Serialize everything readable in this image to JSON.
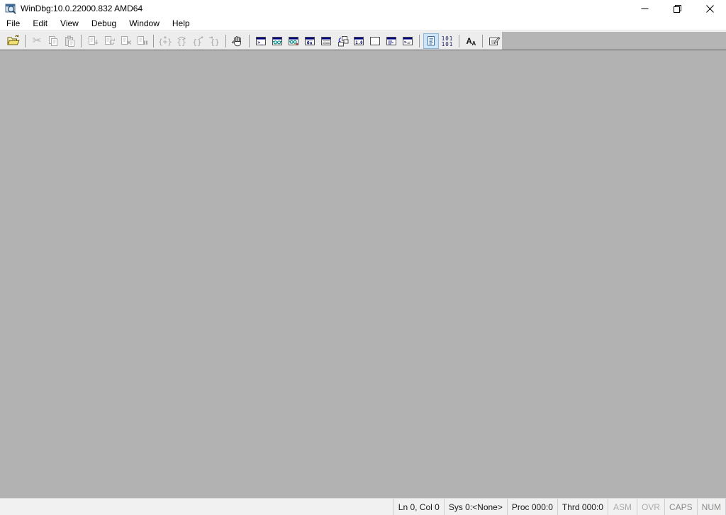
{
  "window": {
    "title": "WinDbg:10.0.22000.832 AMD64",
    "app_icon": "windbg-icon",
    "controls": {
      "minimize": "Minimize",
      "restore": "Restore Down",
      "close": "Close"
    }
  },
  "menu": {
    "items": [
      "File",
      "Edit",
      "View",
      "Debug",
      "Window",
      "Help"
    ]
  },
  "toolbar": {
    "buttons": [
      {
        "name": "Open source file",
        "icon": "open-folder-icon",
        "enabled": true
      },
      {
        "name": "Cut",
        "icon": "scissors-icon",
        "enabled": false
      },
      {
        "name": "Copy",
        "icon": "copy-icon",
        "enabled": false
      },
      {
        "name": "Paste",
        "icon": "paste-icon",
        "enabled": false
      },
      {
        "name": "Go",
        "icon": "doc-go-icon",
        "enabled": false
      },
      {
        "name": "Restart",
        "icon": "doc-restart-icon",
        "enabled": false
      },
      {
        "name": "Stop debugging",
        "icon": "doc-stop-icon",
        "enabled": false
      },
      {
        "name": "Break",
        "icon": "doc-break-icon",
        "enabled": false
      },
      {
        "name": "Step into",
        "icon": "step-into-icon",
        "enabled": false
      },
      {
        "name": "Step over",
        "icon": "step-over-icon",
        "enabled": false
      },
      {
        "name": "Step out",
        "icon": "step-out-icon",
        "enabled": false
      },
      {
        "name": "Run to cursor",
        "icon": "run-to-cursor-icon",
        "enabled": false
      },
      {
        "name": "Insert or remove breakpoint",
        "icon": "hand-icon",
        "enabled": true
      },
      {
        "name": "Open command window",
        "icon": "command-window-icon",
        "enabled": true
      },
      {
        "name": "Open watch window",
        "icon": "watch-window-icon",
        "enabled": true
      },
      {
        "name": "Open locals window",
        "icon": "locals-window-icon",
        "enabled": true
      },
      {
        "name": "Open registers window",
        "icon": "registers-window-icon",
        "enabled": true
      },
      {
        "name": "Open memory window",
        "icon": "memory-window-icon",
        "enabled": true
      },
      {
        "name": "Open call stack window",
        "icon": "call-stack-icon",
        "enabled": true
      },
      {
        "name": "Open disassembly window",
        "icon": "disassembly-window-icon",
        "enabled": true
      },
      {
        "name": "Open scratch pad",
        "icon": "scratch-pad-icon",
        "enabled": true
      },
      {
        "name": "Open processes and threads window",
        "icon": "processes-window-icon",
        "enabled": true
      },
      {
        "name": "Open command browser window",
        "icon": "command-browser-icon",
        "enabled": true
      },
      {
        "name": "Source mode on",
        "icon": "source-doc-icon",
        "enabled": true,
        "pressed": true
      },
      {
        "name": "Source mode off (assembly)",
        "icon": "101-101-icon",
        "enabled": true
      },
      {
        "name": "Font",
        "icon": "font-aa-icon",
        "enabled": true
      },
      {
        "name": "Options",
        "icon": "options-doc-pencil-icon",
        "enabled": true
      }
    ]
  },
  "workspace": {
    "content": ""
  },
  "status": {
    "items": [
      {
        "label": "Ln 0, Col 0",
        "state": "normal"
      },
      {
        "label": "Sys 0:<None>",
        "state": "normal"
      },
      {
        "label": "Proc 000:0",
        "state": "normal"
      },
      {
        "label": "Thrd 000:0",
        "state": "normal"
      },
      {
        "label": "ASM",
        "state": "disabled"
      },
      {
        "label": "OVR",
        "state": "disabled"
      },
      {
        "label": "CAPS",
        "state": "dim"
      },
      {
        "label": "NUM",
        "state": "dim"
      }
    ]
  },
  "colors": {
    "titlebar_bg": "#ffffff",
    "toolbar_panel_bg": "#ededed",
    "toolbar_strip_bg": "#b5b5b5",
    "workspace_bg": "#b2b2b2",
    "statusbar_bg": "#f1f1f1",
    "pressed_button_bg": "#cfe4f6",
    "pressed_button_border": "#86b7dd",
    "mini_window_titlebar": "#000080",
    "disabled_icon": "#a8a8a8"
  }
}
